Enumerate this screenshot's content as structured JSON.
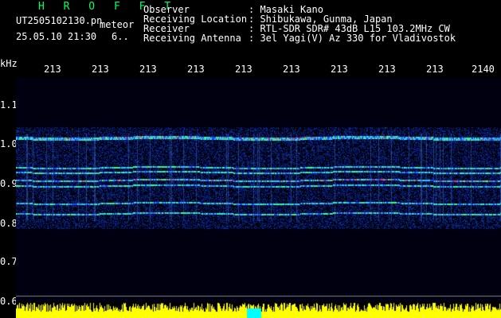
{
  "app": {
    "title": "H R O F F T",
    "filename": "UT2505102130.pn",
    "mode": "meteor",
    "datetime": "25.05.10 21:30",
    "counter": "6.."
  },
  "info": {
    "labels": [
      "Observer",
      "Receiving Location",
      "Receiver",
      "Receiving Antenna"
    ],
    "values": [
      ": Masaki Kano",
      ": Shibukawa, Gunma, Japan",
      ": RTL-SDR SDR# 43dB L15 103.2MHz CW",
      ": 3el Yagi(V) Az 330 for Vladivostok"
    ]
  },
  "y_axis": {
    "unit": "kHz",
    "ticks": [
      "1.1",
      "1.0",
      "0.9",
      "0.8",
      "0.7",
      "0.6"
    ]
  },
  "x_axis": {
    "ticks": [
      "213",
      "213",
      "213",
      "213",
      "213",
      "213",
      "213",
      "213",
      "213",
      "2140"
    ]
  },
  "colors": {
    "background": "#000000",
    "plot_bg": "#000028",
    "text": "#ffffff",
    "title_green": "#00ff66",
    "signal_blue": "#1e3cc8",
    "signal_hot": "#ff3030",
    "baseline_yellow": "#ffff00"
  }
}
